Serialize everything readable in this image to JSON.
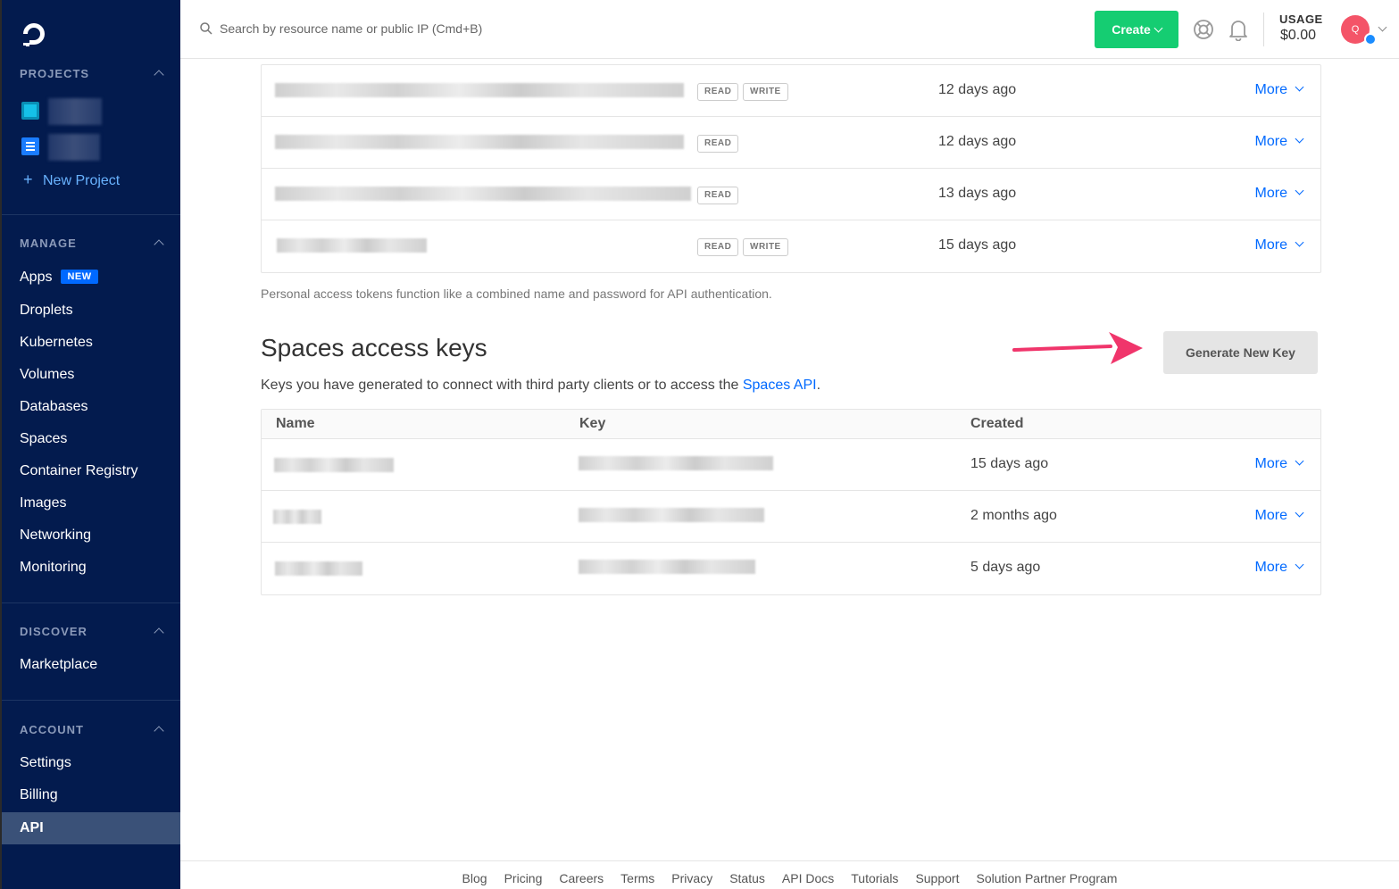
{
  "sidebar": {
    "projects_heading": "PROJECTS",
    "new_project": "New Project",
    "manage_heading": "MANAGE",
    "manage_items": [
      {
        "label": "Apps",
        "badge": "NEW"
      },
      {
        "label": "Droplets"
      },
      {
        "label": "Kubernetes"
      },
      {
        "label": "Volumes"
      },
      {
        "label": "Databases"
      },
      {
        "label": "Spaces"
      },
      {
        "label": "Container Registry"
      },
      {
        "label": "Images"
      },
      {
        "label": "Networking"
      },
      {
        "label": "Monitoring"
      }
    ],
    "discover_heading": "DISCOVER",
    "discover_items": [
      {
        "label": "Marketplace"
      }
    ],
    "account_heading": "ACCOUNT",
    "account_items": [
      {
        "label": "Settings"
      },
      {
        "label": "Billing"
      },
      {
        "label": "API",
        "active": true
      }
    ]
  },
  "header": {
    "search_placeholder": "Search by resource name or public IP (Cmd+B)",
    "create_label": "Create",
    "usage_label": "USAGE",
    "usage_value": "$0.00",
    "avatar_initial": "Q"
  },
  "tokens": {
    "rows": [
      {
        "scopes": [
          "READ",
          "WRITE"
        ],
        "created": "12 days ago",
        "more": "More"
      },
      {
        "scopes": [
          "READ"
        ],
        "created": "12 days ago",
        "more": "More"
      },
      {
        "scopes": [
          "READ"
        ],
        "created": "13 days ago",
        "more": "More"
      },
      {
        "scopes": [
          "READ",
          "WRITE"
        ],
        "created": "15 days ago",
        "more": "More"
      }
    ],
    "note": "Personal access tokens function like a combined name and password for API authentication."
  },
  "spaces": {
    "title": "Spaces access keys",
    "desc_prefix": "Keys you have generated to connect with third party clients or to access the ",
    "desc_link": "Spaces API",
    "desc_suffix": ".",
    "generate_label": "Generate New Key",
    "columns": {
      "name": "Name",
      "key": "Key",
      "created": "Created"
    },
    "rows": [
      {
        "created": "15 days ago",
        "more": "More"
      },
      {
        "created": "2 months ago",
        "more": "More"
      },
      {
        "created": "5 days ago",
        "more": "More"
      }
    ]
  },
  "footer": {
    "links": [
      "Blog",
      "Pricing",
      "Careers",
      "Terms",
      "Privacy",
      "Status",
      "API Docs",
      "Tutorials",
      "Support",
      "Solution Partner Program"
    ]
  },
  "colors": {
    "sidebar_bg": "#031b4e",
    "accent_blue": "#0069ff",
    "create_green": "#15cd72",
    "annotation_arrow": "#f0356b"
  }
}
